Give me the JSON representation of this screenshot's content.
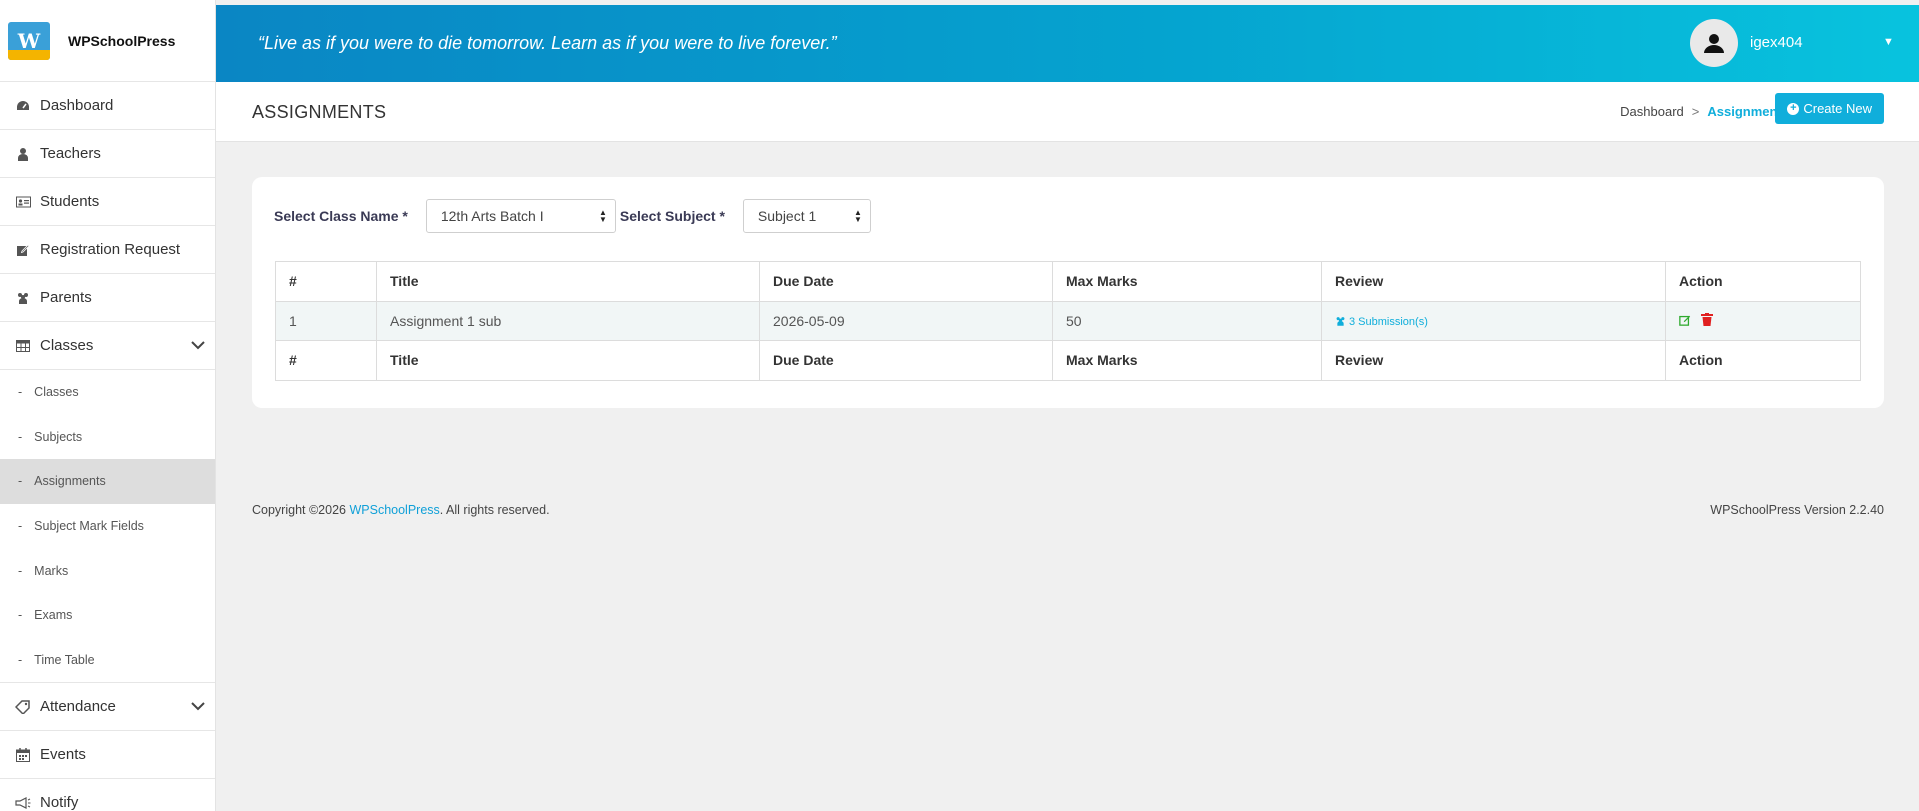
{
  "brand": {
    "name": "WPSchoolPress"
  },
  "header": {
    "quote": "“Live as if you were to die tomorrow. Learn as if you were to live forever.”",
    "username": "igex404"
  },
  "sidebar": {
    "items": [
      {
        "label": "Dashboard",
        "icon": "dashboard-icon"
      },
      {
        "label": "Teachers",
        "icon": "user-icon"
      },
      {
        "label": "Students",
        "icon": "id-card-icon"
      },
      {
        "label": "Registration Request",
        "icon": "edit-icon"
      },
      {
        "label": "Parents",
        "icon": "users-icon"
      },
      {
        "label": "Classes",
        "icon": "table-icon"
      }
    ],
    "class_subitems": [
      "Classes",
      "Subjects",
      "Assignments",
      "Subject Mark Fields",
      "Marks",
      "Exams",
      "Time Table"
    ],
    "active_subitem": "Assignments",
    "bottom_items": [
      {
        "label": "Attendance",
        "icon": "tag-icon"
      },
      {
        "label": "Events",
        "icon": "calendar-icon"
      },
      {
        "label": "Notify",
        "icon": "megaphone-icon"
      }
    ]
  },
  "page": {
    "title": "ASSIGNMENTS",
    "breadcrumb": {
      "root": "Dashboard",
      "current": "Assignments"
    },
    "create_label": "Create New"
  },
  "filters": {
    "class_label": "Select Class Name *",
    "class_value": "12th Arts Batch I",
    "subject_label": "Select Subject *",
    "subject_value": "Subject 1"
  },
  "table": {
    "columns": [
      "#",
      "Title",
      "Due Date",
      "Max Marks",
      "Review",
      "Action"
    ],
    "rows": [
      {
        "num": "1",
        "title": "Assignment 1 sub",
        "due": "2026-05-09",
        "max": "50",
        "review": "3 Submission(s)"
      }
    ]
  },
  "footer": {
    "copyright_prefix": "Copyright ©2026 ",
    "brand_link": "WPSchoolPress",
    "copyright_suffix": ". All rights reserved.",
    "version": "WPSchoolPress Version 2.2.40"
  },
  "colors": {
    "accent": "#10aedb",
    "header_start": "#0a86c4",
    "header_end": "#08c3de",
    "delete": "#e02020",
    "edit": "#2eaa2e"
  }
}
